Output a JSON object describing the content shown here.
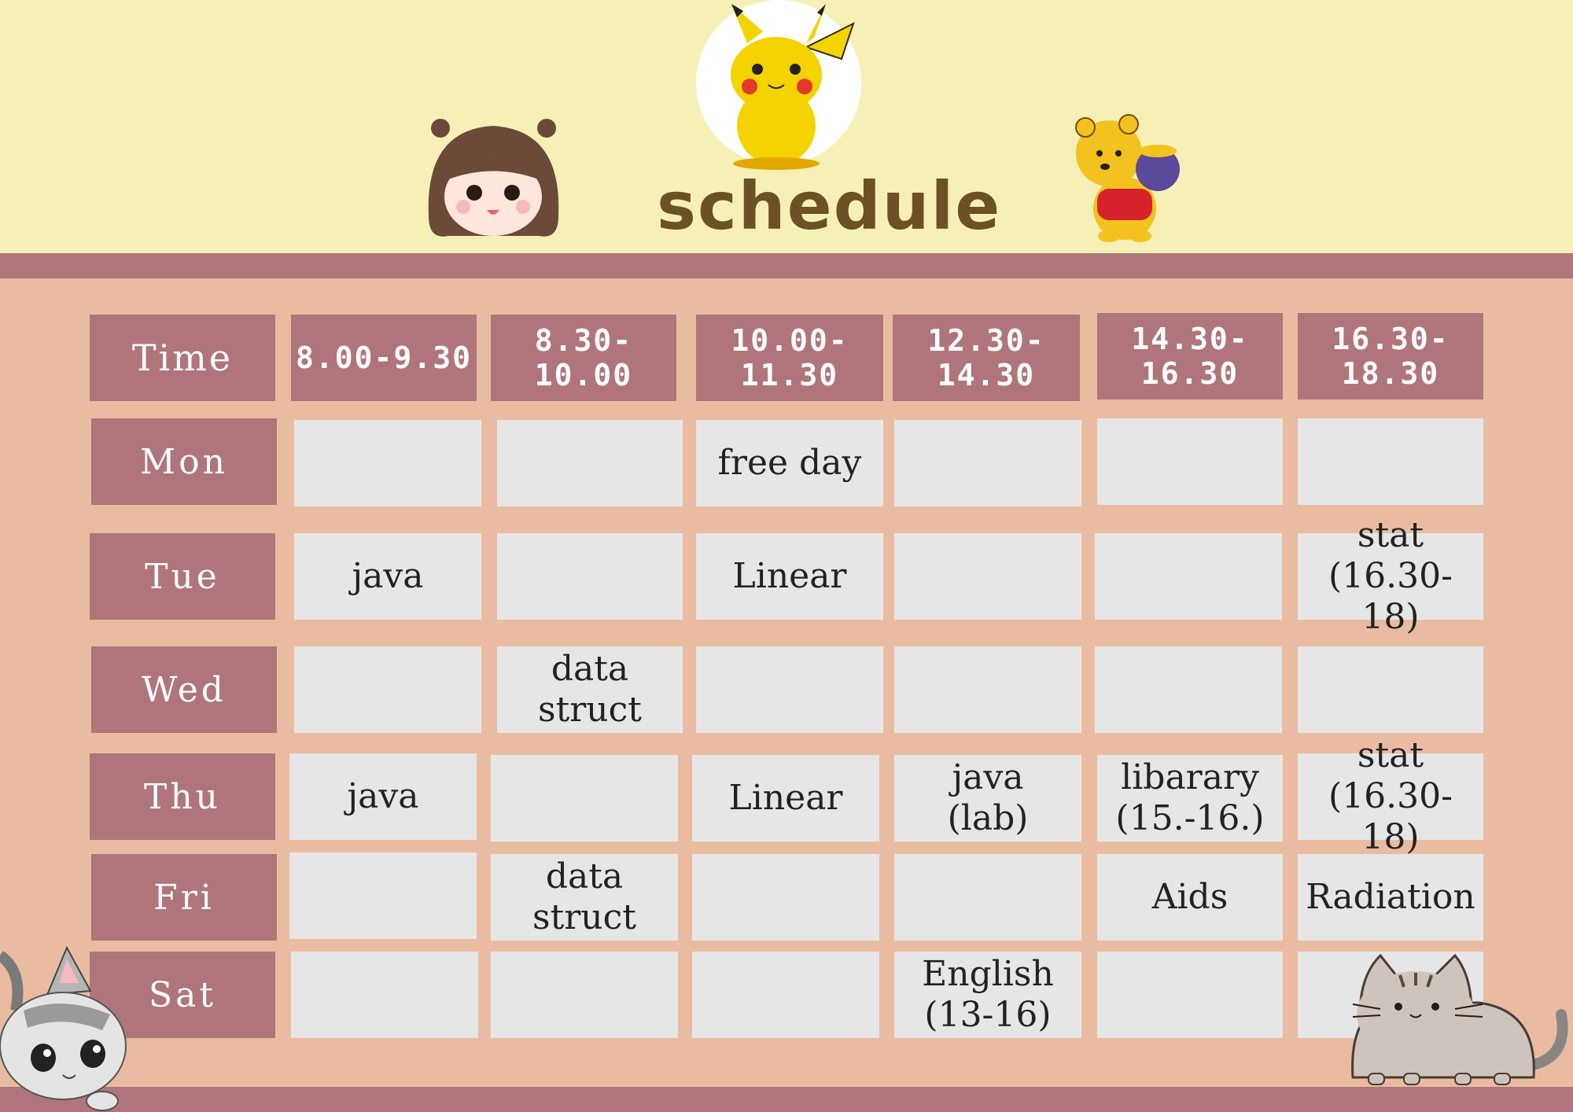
{
  "title": "schedule",
  "header": {
    "corner": "Time",
    "slots": [
      "8.00-9.30",
      "8.30-10.00",
      "10.00-11.30",
      "12.30-14.30",
      "14.30-16.30",
      "16.30-18.30"
    ]
  },
  "days": [
    "Mon",
    "Tue",
    "Wed",
    "Thu",
    "Fri",
    "Sat"
  ],
  "cells": [
    [
      "",
      "",
      "free day",
      "",
      "",
      ""
    ],
    [
      "java",
      "",
      "Linear",
      "",
      "",
      "stat\n(16.30-18)"
    ],
    [
      "",
      "data struct",
      "",
      "",
      "",
      ""
    ],
    [
      "java",
      "",
      "Linear",
      "java\n(lab)",
      "libarary\n(15.-16.)",
      "stat\n(16.30-18)"
    ],
    [
      "",
      "data struct",
      "",
      "",
      "Aids",
      "Radiation"
    ],
    [
      "",
      "",
      "",
      "English\n(13-16)",
      "",
      ""
    ]
  ],
  "colors": {
    "background_top": "#f6f0b6",
    "stripe": "#b0757b",
    "table_background": "#e9bca2",
    "header_cell": "#b0757b",
    "body_cell": "#e6e6e6",
    "title": "#6b5124"
  },
  "decorations": [
    "pikachu-illustration",
    "girl-face-illustration",
    "pooh-bear-illustration",
    "kitten-illustration",
    "pusheen-cat-illustration"
  ]
}
